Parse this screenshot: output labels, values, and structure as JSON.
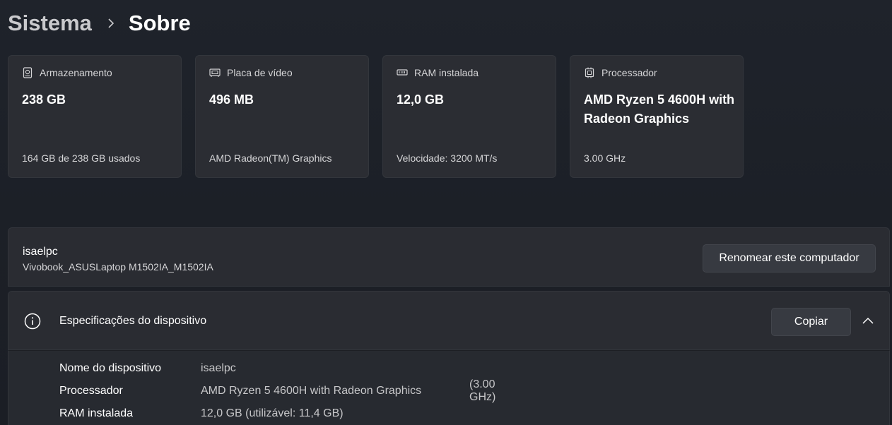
{
  "breadcrumb": {
    "parent": "Sistema",
    "current": "Sobre"
  },
  "cards": [
    {
      "icon": "storage-icon",
      "title": "Armazenamento",
      "value": "238 GB",
      "sub": "164 GB de 238 GB usados"
    },
    {
      "icon": "gpu-icon",
      "title": "Placa de vídeo",
      "value": "496 MB",
      "sub": "AMD Radeon(TM) Graphics"
    },
    {
      "icon": "ram-icon",
      "title": "RAM instalada",
      "value": "12,0 GB",
      "sub": "Velocidade: 3200 MT/s"
    },
    {
      "icon": "cpu-icon",
      "title": "Processador",
      "value": "AMD Ryzen 5 4600H with Radeon Graphics",
      "sub": "3.00 GHz"
    }
  ],
  "device": {
    "name": "isaelpc",
    "model": "Vivobook_ASUSLaptop M1502IA_M1502IA",
    "rename_label": "Renomear este computador"
  },
  "specs": {
    "title": "Especificações do dispositivo",
    "copy_label": "Copiar",
    "rows": [
      {
        "label": "Nome do dispositivo",
        "value": "isaelpc",
        "extra": ""
      },
      {
        "label": "Processador",
        "value": "AMD Ryzen 5 4600H with Radeon Graphics",
        "extra": "(3.00 GHz)"
      },
      {
        "label": "RAM instalada",
        "value": "12,0 GB (utilizável: 11,4 GB)",
        "extra": ""
      }
    ]
  },
  "colors": {
    "background": "#1c1f26",
    "card": "#2b2d33",
    "button": "#373a41"
  }
}
